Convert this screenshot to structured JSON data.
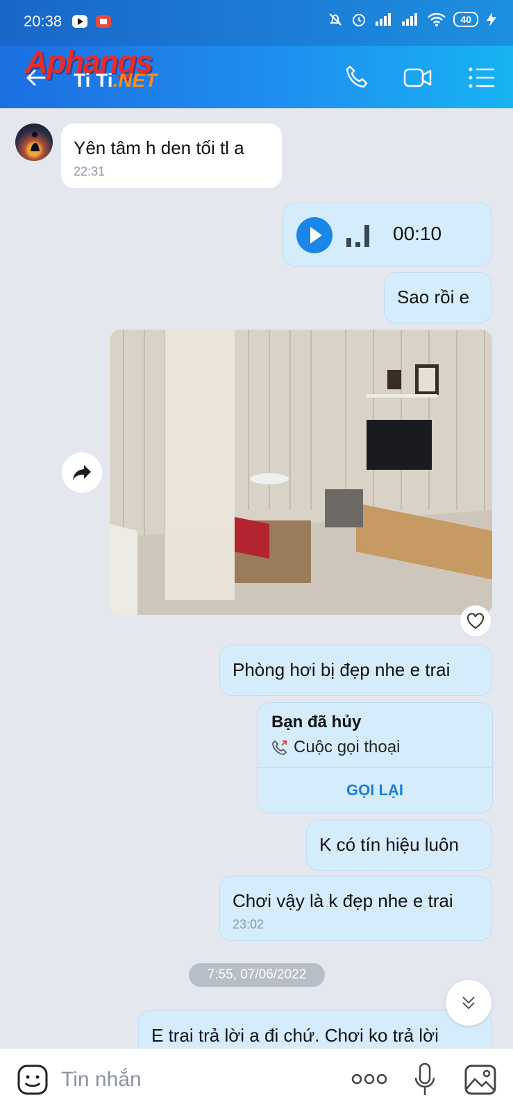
{
  "status": {
    "time": "20:38",
    "battery": "40"
  },
  "header": {
    "logo_line1": "Aphangs",
    "logo_line2": "Ti Ti",
    "logo_line3": ".NET"
  },
  "messages": {
    "m1": {
      "text": "Yên tâm h den tối tl a",
      "time": "22:31"
    },
    "voice": {
      "duration": "00:10"
    },
    "m2": {
      "text": "Sao rồi e"
    },
    "m3": {
      "text": "Phòng hơi bị đẹp nhe e trai"
    },
    "call": {
      "title": "Bạn đã hủy",
      "subtitle": "Cuộc gọi thoại",
      "action": "GỌI LẠI"
    },
    "m4": {
      "text": "K có tín hiệu luôn"
    },
    "m5": {
      "text": "Chơi vậy là k đẹp nhe e trai",
      "time": "23:02"
    },
    "date_sep": "7:55, 07/06/2022",
    "m6": {
      "text": "E trai trả lời a đi chứ. Chơi ko trả lời"
    }
  },
  "composer": {
    "placeholder": "Tin nhắn"
  },
  "colors": {
    "accent": "#1f8ff0",
    "bubble_out": "#d5ecfd",
    "link": "#1a7fd6"
  }
}
